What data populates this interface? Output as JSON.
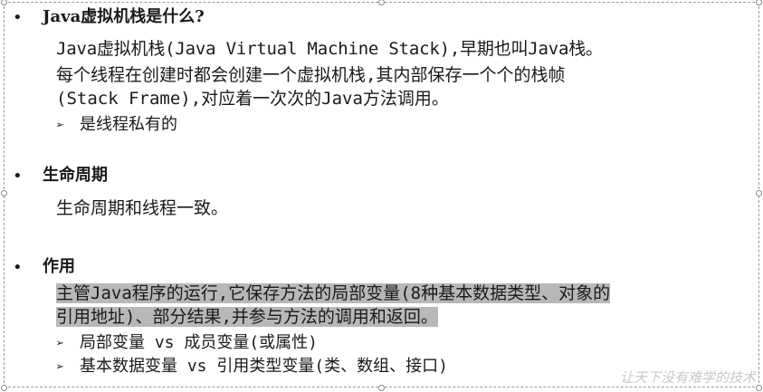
{
  "sections": [
    {
      "heading": "Java虚拟机栈是什么?",
      "lines": [
        "Java虚拟机栈(Java Virtual Machine Stack),早期也叫Java栈。",
        "每个线程在创建时都会创建一个虚拟机栈,其内部保存一个个的栈帧",
        "(Stack Frame),对应着一次次的Java方法调用。"
      ],
      "points": [
        "是线程私有的"
      ]
    },
    {
      "heading": "生命周期",
      "lines": [
        "生命周期和线程一致。"
      ],
      "points": []
    },
    {
      "heading": "作用",
      "lines": [
        "主管Java程序的运行,它保存方法的局部变量(8种基本数据类型、对象的",
        "引用地址)、部分结果,并参与方法的调用和返回。"
      ],
      "points": [
        "局部变量 vs 成员变量(或属性)",
        "基本数据变量  vs 引用类型变量(类、数组、接口)"
      ]
    }
  ],
  "bullet_symbol": "•",
  "arrow_symbol": "➢",
  "watermark": "让天下没有难学的技术",
  "colors": {
    "highlight": "#b8b8b8",
    "text": "#1a1a1a",
    "frame": "#9a9a9a"
  }
}
